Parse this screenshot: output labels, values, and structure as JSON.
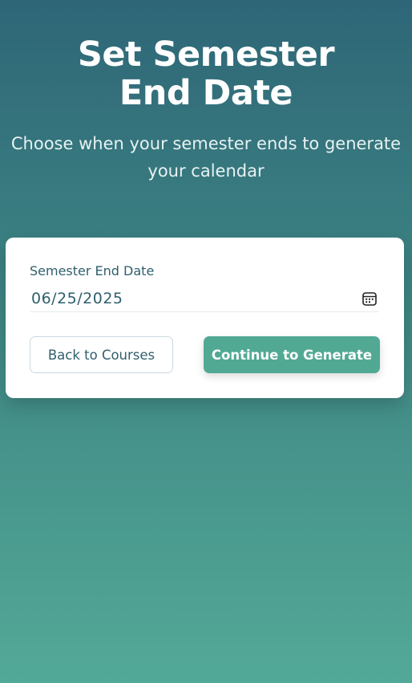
{
  "header": {
    "title": "Set Semester End Date",
    "subtitle": "Choose when your semester ends to generate your calendar"
  },
  "form": {
    "label": "Semester End Date",
    "date_value": "06/25/2025",
    "calendar_icon": "calendar-icon"
  },
  "buttons": {
    "back_label": "Back to Courses",
    "continue_label": "Continue to Generate"
  },
  "colors": {
    "gradient_top": "#2e6677",
    "gradient_bottom": "#53a997",
    "accent": "#52a993",
    "text_dark": "#2f5f6d"
  }
}
